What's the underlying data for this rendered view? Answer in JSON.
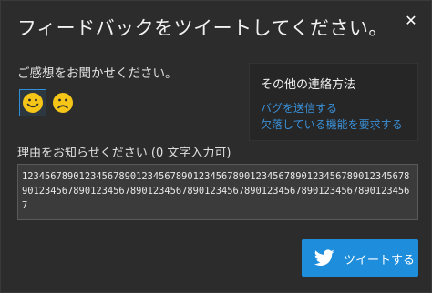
{
  "dialog": {
    "title": "フィードバックをツイートしてください。",
    "close_icon": "✕"
  },
  "feeling": {
    "label": "ご感想をお聞かせください。",
    "options": [
      {
        "name": "happy",
        "selected": true
      },
      {
        "name": "sad",
        "selected": false
      }
    ]
  },
  "contact": {
    "title": "その他の連絡方法",
    "links": [
      {
        "label": "バグを送信する"
      },
      {
        "label": "欠落している機能を要求する"
      }
    ]
  },
  "reason": {
    "label": "理由をお知らせください (0 文字入力可)",
    "value": "12345678901234567890123456789012345678901234567890123456789012345678901234567890123456789012345678901234567890123456789012345678901234567"
  },
  "tweet_button": {
    "label": "ツイートする"
  },
  "colors": {
    "accent": "#1d8ddc",
    "link": "#3a8fd6",
    "face": "#f5c518"
  }
}
